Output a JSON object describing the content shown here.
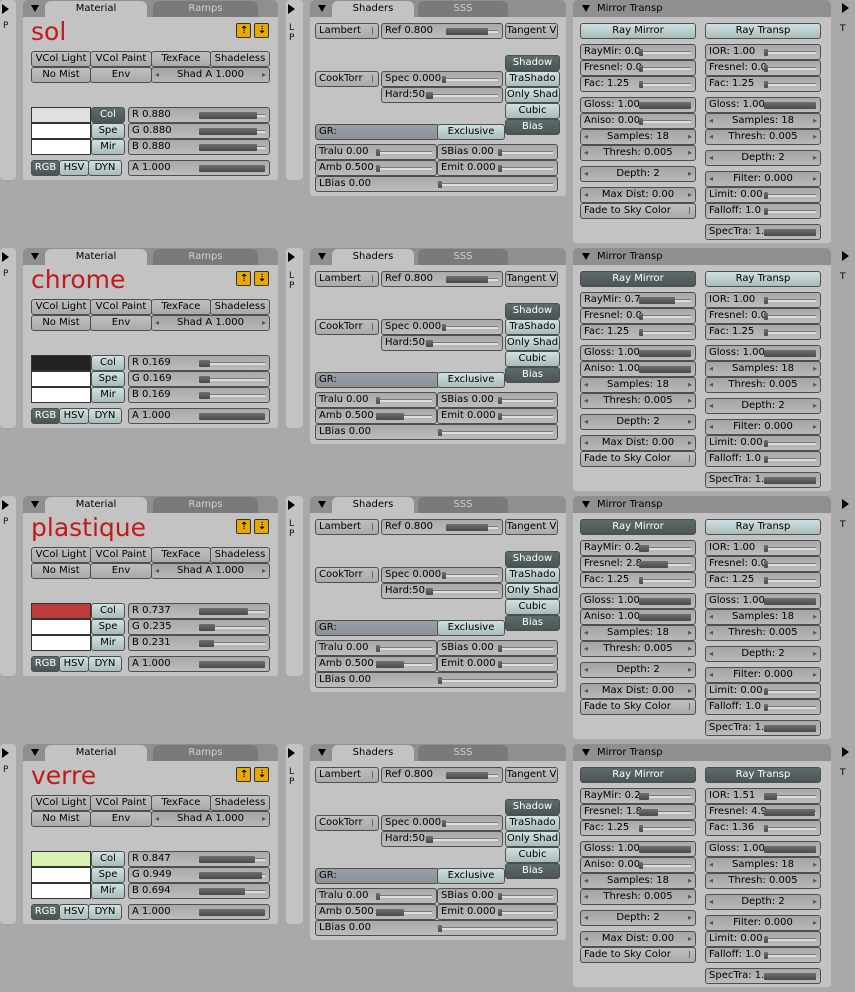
{
  "labels": {
    "material_tab": "Material",
    "ramps_tab": "Ramps",
    "shaders_tab": "Shaders",
    "sss_tab": "SSS",
    "mirror_header": "Mirror Transp",
    "side_p": "P",
    "side_lp_l": "L",
    "side_lp_p": "P",
    "side_t": "T",
    "vcol_light": "VCol Light",
    "vcol_paint": "VCol Paint",
    "texface": "TexFace",
    "shadeless": "Shadeless",
    "no_mist": "No Mist",
    "env": "Env",
    "shad_a": "Shad A 1.000",
    "col": "Col",
    "spe": "Spe",
    "mir": "Mir",
    "rgb": "RGB",
    "hsv": "HSV",
    "dyn": "DYN",
    "lambert": "Lambert",
    "ref": "Ref  0.800",
    "tangent": "Tangent V",
    "cooktorr": "CookTorr",
    "spec": "Spec 0.000",
    "hard": "Hard:50",
    "shadow": "Shadow",
    "trashado": "TraShado",
    "onlyshad": "Only Shad",
    "cubic": "Cubic",
    "bias": "Bias",
    "gr": "GR:",
    "exclusive": "Exclusive",
    "tralu": "Tralu 0.00",
    "sbias": "SBias 0.00",
    "amb": "Amb 0.500",
    "emit": "Emit 0.000",
    "lbias": "LBias 0.00",
    "ray_mirror": "Ray Mirror",
    "ray_transp": "Ray Transp",
    "samples": "Samples: 18",
    "thresh_m": "Thresh: 0.005",
    "thresh_t": "Thresh: 0.005",
    "depth": "Depth: 2",
    "filter": "Filter: 0.000",
    "limit": "Limit: 0.00",
    "maxdist": "Max Dist: 0.00",
    "fade": "Fade to Sky Color",
    "falloff": "Falloff: 1.0",
    "spectra": "SpecTra: 1."
  },
  "materials": [
    {
      "name": "sol",
      "color": "#e0e0e0",
      "r": "R 0.880",
      "g": "G 0.880",
      "b": "B 0.880",
      "rv": 0.88,
      "gv": 0.88,
      "bv": 0.88,
      "a": "A 1.000",
      "col_active": false,
      "ray_mirror_on": false,
      "ray_transp_on": false,
      "raymir": "RayMir: 0.0",
      "raymir_v": 0.0,
      "fresnel_m": "Fresnel: 0.0",
      "fresnel_m_v": 0.0,
      "fac_m": "Fac: 1.25",
      "gloss_m": "Gloss: 1.00",
      "aniso": "Aniso: 0.00",
      "aniso_v": 0.0,
      "ior": "IOR: 1.00",
      "ior_v": 0.0,
      "fresnel_t": "Fresnel: 0.0",
      "fresnel_t_v": 0.0,
      "fac_t": "Fac: 1.25",
      "gloss_t": "Gloss: 1.00"
    },
    {
      "name": "chrome",
      "color": "#222222",
      "r": "R 0.169",
      "g": "G 0.169",
      "b": "B 0.169",
      "rv": 0.169,
      "gv": 0.169,
      "bv": 0.169,
      "a": "A 1.000",
      "col_active": true,
      "ray_mirror_on": true,
      "ray_transp_on": false,
      "raymir": "RayMir: 0.7",
      "raymir_v": 0.7,
      "fresnel_m": "Fresnel: 0.0",
      "fresnel_m_v": 0.0,
      "fac_m": "Fac: 1.25",
      "gloss_m": "Gloss: 1.00",
      "aniso": "Aniso: 1.00",
      "aniso_v": 1.0,
      "ior": "IOR: 1.00",
      "ior_v": 0.0,
      "fresnel_t": "Fresnel: 0.0",
      "fresnel_t_v": 0.0,
      "fac_t": "Fac: 1.25",
      "gloss_t": "Gloss: 1.00"
    },
    {
      "name": "plastique",
      "color": "#bc3b3b",
      "r": "R 0.737",
      "g": "G 0.235",
      "b": "B 0.231",
      "rv": 0.737,
      "gv": 0.235,
      "bv": 0.231,
      "a": "A 1.000",
      "col_active": true,
      "ray_mirror_on": true,
      "ray_transp_on": false,
      "raymir": "RayMir: 0.2",
      "raymir_v": 0.2,
      "fresnel_m": "Fresnel: 2.8",
      "fresnel_m_v": 0.56,
      "fac_m": "Fac: 1.25",
      "gloss_m": "Gloss: 1.00",
      "aniso": "Aniso: 1.00",
      "aniso_v": 1.0,
      "ior": "IOR: 1.00",
      "ior_v": 0.0,
      "fresnel_t": "Fresnel: 0.0",
      "fresnel_t_v": 0.0,
      "fac_t": "Fac: 1.25",
      "gloss_t": "Gloss: 1.00"
    },
    {
      "name": "verre",
      "color": "#d8f2b1",
      "r": "R 0.847",
      "g": "G 0.949",
      "b": "B 0.694",
      "rv": 0.847,
      "gv": 0.949,
      "bv": 0.694,
      "a": "A 1.000",
      "col_active": true,
      "ray_mirror_on": true,
      "ray_transp_on": true,
      "raymir": "RayMir: 0.2",
      "raymir_v": 0.2,
      "fresnel_m": "Fresnel: 1.8",
      "fresnel_m_v": 0.36,
      "fac_m": "Fac: 1.25",
      "gloss_m": "Gloss: 1.00",
      "aniso": "Aniso: 0.00",
      "aniso_v": 0.0,
      "ior": "IOR: 1.51",
      "ior_v": 0.25,
      "fresnel_t": "Fresnel: 4.9",
      "fresnel_t_v": 0.98,
      "fac_t": "Fac: 1.36",
      "gloss_t": "Gloss: 1.00"
    }
  ]
}
